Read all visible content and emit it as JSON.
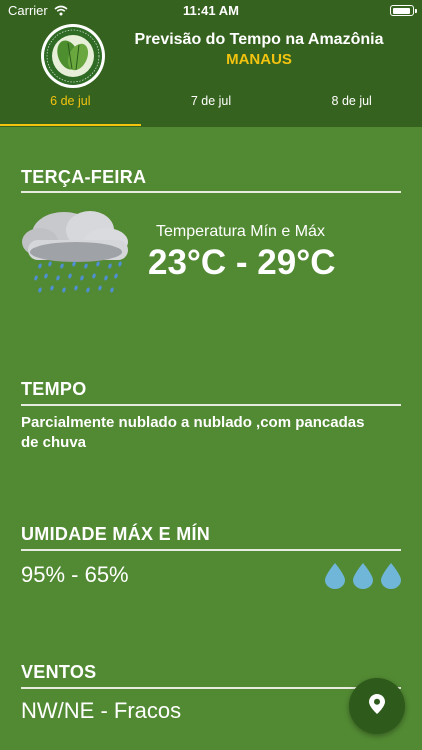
{
  "status_bar": {
    "carrier": "Carrier",
    "time": "11:41 AM"
  },
  "header": {
    "title": "Previsão do Tempo na Amazônia",
    "city": "MANAUS",
    "logo_text": "SISTEMA DE PROTEÇÃO DA AMAZÔNIA",
    "logo_abbr": "SIPAM"
  },
  "tabs": [
    {
      "label": "6 de jul",
      "active": true
    },
    {
      "label": "7 de jul",
      "active": false
    },
    {
      "label": "8 de jul",
      "active": false
    }
  ],
  "day": {
    "title": "TERÇA-FEIRA",
    "icon": "cloud-rain-icon"
  },
  "temperature": {
    "label": "Temperatura Mín e Máx",
    "value": "23°C - 29°C"
  },
  "weather": {
    "title": "TEMPO",
    "description": "Parcialmente nublado a nublado ,com pancadas de chuva"
  },
  "humidity": {
    "title": "UMIDADE MÁX E MÍN",
    "value": "95% - 65%",
    "icon": "water-drops-icon"
  },
  "wind": {
    "title": "VENTOS",
    "value": "NW/NE - Fracos"
  },
  "fab": {
    "icon": "location-pin-icon"
  },
  "colors": {
    "background": "#528a33",
    "header": "#36621f",
    "accent": "#f2c30f",
    "drop": "#6fb6d9"
  }
}
